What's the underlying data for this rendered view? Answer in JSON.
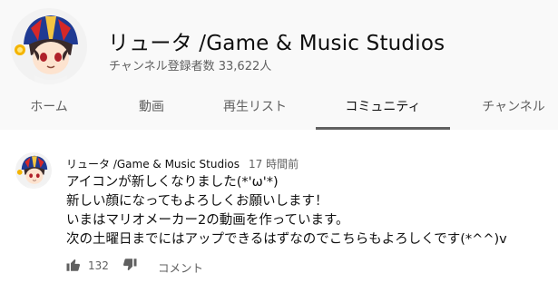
{
  "channel": {
    "name": "リュータ /Game & Music Studios",
    "subscribers": "チャンネル登録者数 33,622人"
  },
  "tabs": [
    {
      "label": "ホーム"
    },
    {
      "label": "動画"
    },
    {
      "label": "再生リスト"
    },
    {
      "label": "コミュニティ",
      "active": true
    },
    {
      "label": "チャンネル"
    }
  ],
  "post": {
    "author": "リュータ /Game & Music Studios",
    "time": "17 時間前",
    "lines": [
      "アイコンが新しくなりました(*'ω'*)",
      "新しい顔になってもよろしくお願いします！",
      "いまはマリオメーカー2の動画を作っています。",
      "次の土曜日までにはアップできるはずなのでこちらもよろしくです(*^^)v"
    ],
    "like_count": "132",
    "comment_label": "コメント"
  },
  "icons": {
    "like": "thumb-up-icon",
    "dislike": "thumb-down-icon"
  },
  "colors": {
    "header_bg": "#f9f9f9",
    "secondary_text": "#606060",
    "primary_text": "#0f0f0f"
  }
}
